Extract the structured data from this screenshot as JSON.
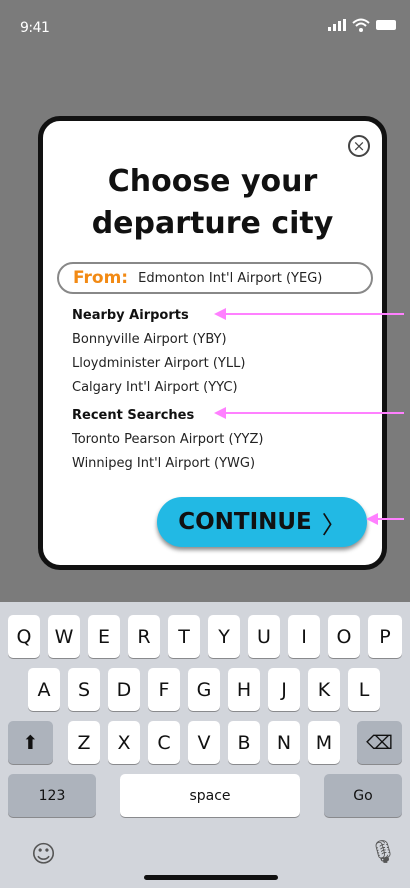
{
  "status_bar": {
    "time": "9:41"
  },
  "modal": {
    "title_line1": "Choose your",
    "title_line2": "departure city",
    "from_label": "From:",
    "from_value": "Edmonton Int'l Airport (YEG)",
    "nearby_title": "Nearby Airports",
    "nearby": [
      "Bonnyville Airport (YBY)",
      "Lloydminister Airport (YLL)",
      "Calgary Int'l Airport (YYC)"
    ],
    "recent_title": "Recent Searches",
    "recent": [
      "Toronto Pearson Airport (YYZ)",
      "Winnipeg Int'l Airport (YWG)"
    ],
    "continue_label": "CONTINUE",
    "continue_chevron": "〉"
  },
  "keyboard": {
    "row1": [
      "Q",
      "W",
      "E",
      "R",
      "T",
      "Y",
      "U",
      "I",
      "O",
      "P"
    ],
    "row2": [
      "A",
      "S",
      "D",
      "F",
      "G",
      "H",
      "J",
      "K",
      "L"
    ],
    "row3": [
      "Z",
      "X",
      "C",
      "V",
      "B",
      "N",
      "M"
    ],
    "numbers_label": "123",
    "space_label": "space",
    "go_label": "Go",
    "shift_icon": "⬆",
    "backspace_icon": "⌫",
    "emoji_icon": "☺",
    "mic_icon": "🎙"
  }
}
